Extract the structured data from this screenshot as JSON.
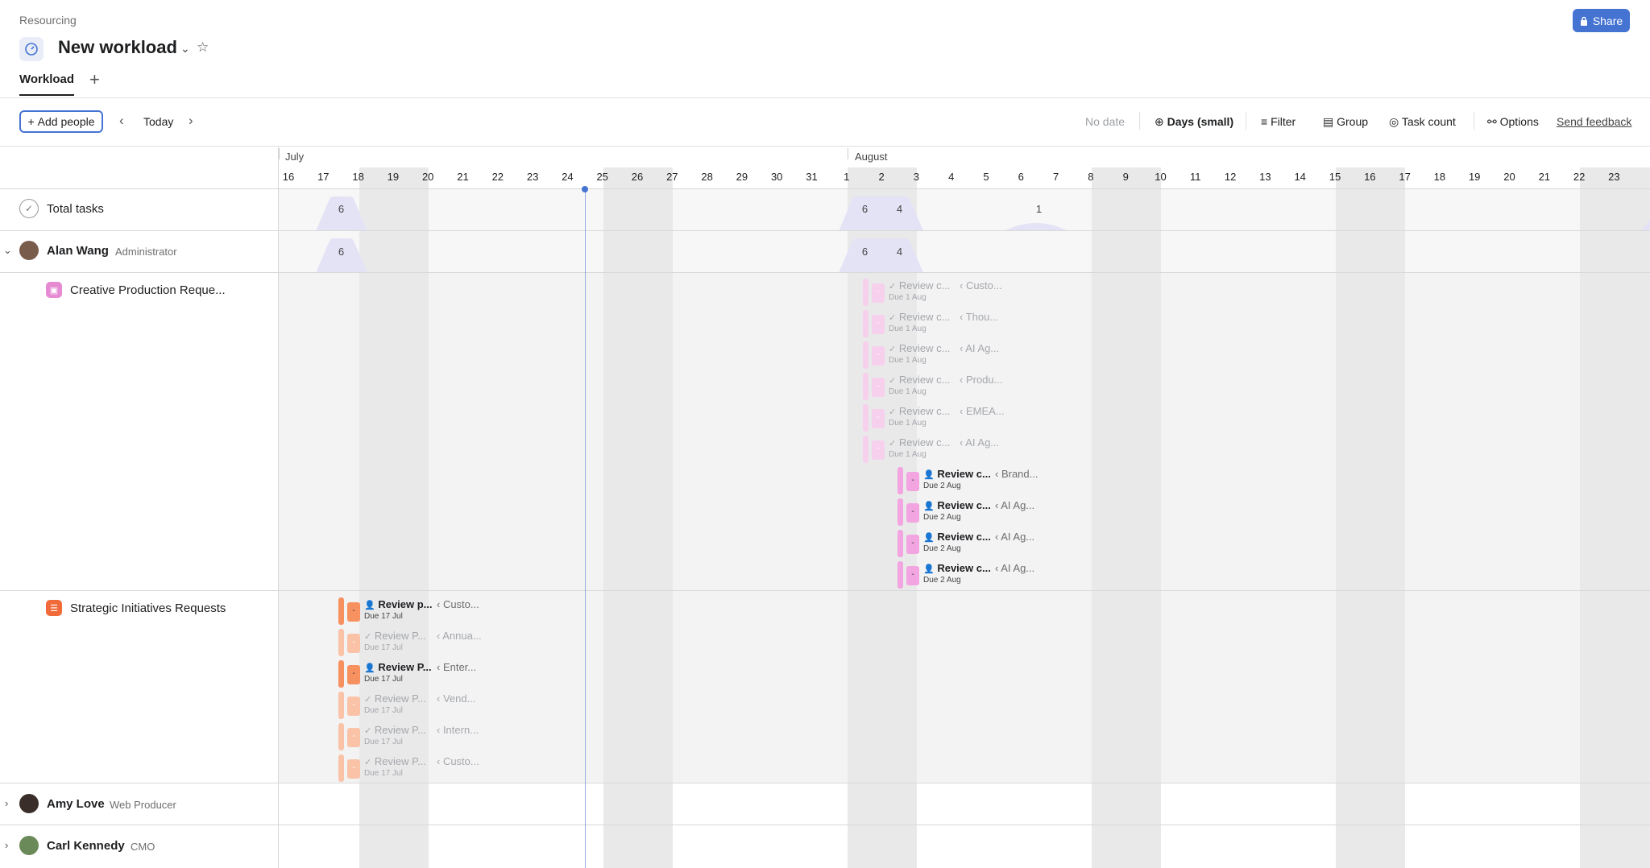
{
  "header": {
    "breadcrumb": "Resourcing",
    "title": "New workload",
    "share_label": "Share"
  },
  "tabs": [
    {
      "label": "Workload"
    }
  ],
  "toolbar": {
    "add_people_label": "Add people",
    "today_label": "Today",
    "no_date_label": "No date",
    "zoom_label": "Days (small)",
    "filter_label": "Filter",
    "group_label": "Group",
    "task_count_label": "Task count",
    "options_label": "Options",
    "feedback_label": "Send feedback"
  },
  "timeline": {
    "months": [
      "July",
      "August"
    ],
    "days": [
      "16",
      "17",
      "18",
      "19",
      "20",
      "21",
      "22",
      "23",
      "24",
      "25",
      "26",
      "27",
      "28",
      "29",
      "30",
      "31",
      "1",
      "2",
      "3",
      "4",
      "5",
      "6",
      "7",
      "8",
      "9",
      "10",
      "11",
      "12",
      "13",
      "14",
      "15",
      "16",
      "17",
      "18",
      "19",
      "20",
      "21",
      "22",
      "23"
    ]
  },
  "rows": {
    "total": {
      "label": "Total tasks",
      "counts": [
        "6",
        "6",
        "4",
        "1"
      ]
    },
    "alan": {
      "name": "Alan Wang",
      "role": "Administrator",
      "counts": [
        "6",
        "6",
        "4"
      ]
    },
    "amy": {
      "name": "Amy Love",
      "role": "Web Producer"
    },
    "carl": {
      "name": "Carl Kennedy",
      "role": "CMO"
    }
  },
  "projects": [
    {
      "name": "Creative Production Reque...",
      "color": "#e68bd3"
    },
    {
      "name": "Strategic Initiatives Requests",
      "color": "#f06a3a"
    }
  ],
  "tasks": {
    "creative": [
      {
        "name": "Review c...",
        "project": "‹ Custo...",
        "due": "Due 1 Aug",
        "pill": "-"
      },
      {
        "name": "Review c...",
        "project": "‹ Thou...",
        "due": "Due 1 Aug",
        "pill": "-"
      },
      {
        "name": "Review c...",
        "project": "‹ AI Ag...",
        "due": "Due 1 Aug",
        "pill": "-"
      },
      {
        "name": "Review c...",
        "project": "‹ Produ...",
        "due": "Due 1 Aug",
        "pill": "-"
      },
      {
        "name": "Review c...",
        "project": "‹ EMEA...",
        "due": "Due 1 Aug",
        "pill": "-"
      },
      {
        "name": "Review c...",
        "project": "‹ AI Ag...",
        "due": "Due 1 Aug",
        "pill": "-"
      },
      {
        "name": "Review c...",
        "project": "‹ Brand...",
        "due": "Due 2 Aug",
        "pill": "-"
      },
      {
        "name": "Review c...",
        "project": "‹ AI Ag...",
        "due": "Due 2 Aug",
        "pill": "-"
      },
      {
        "name": "Review c...",
        "project": "‹ AI Ag...",
        "due": "Due 2 Aug",
        "pill": "-"
      },
      {
        "name": "Review c...",
        "project": "‹ AI Ag...",
        "due": "Due 2 Aug",
        "pill": "-"
      }
    ],
    "strategic": [
      {
        "name": "Review p...",
        "project": "‹ Custo...",
        "due": "Due 17 Jul",
        "pill": "-"
      },
      {
        "name": "Review P...",
        "project": "‹ Annua...",
        "due": "Due 17 Jul",
        "pill": "-"
      },
      {
        "name": "Review P...",
        "project": "‹ Enter...",
        "due": "Due 17 Jul",
        "pill": "-"
      },
      {
        "name": "Review P...",
        "project": "‹ Vend...",
        "due": "Due 17 Jul",
        "pill": "-"
      },
      {
        "name": "Review P...",
        "project": "‹ Intern...",
        "due": "Due 17 Jul",
        "pill": "-"
      },
      {
        "name": "Review P...",
        "project": "‹ Custo...",
        "due": "Due 17 Jul",
        "pill": "-"
      }
    ]
  }
}
